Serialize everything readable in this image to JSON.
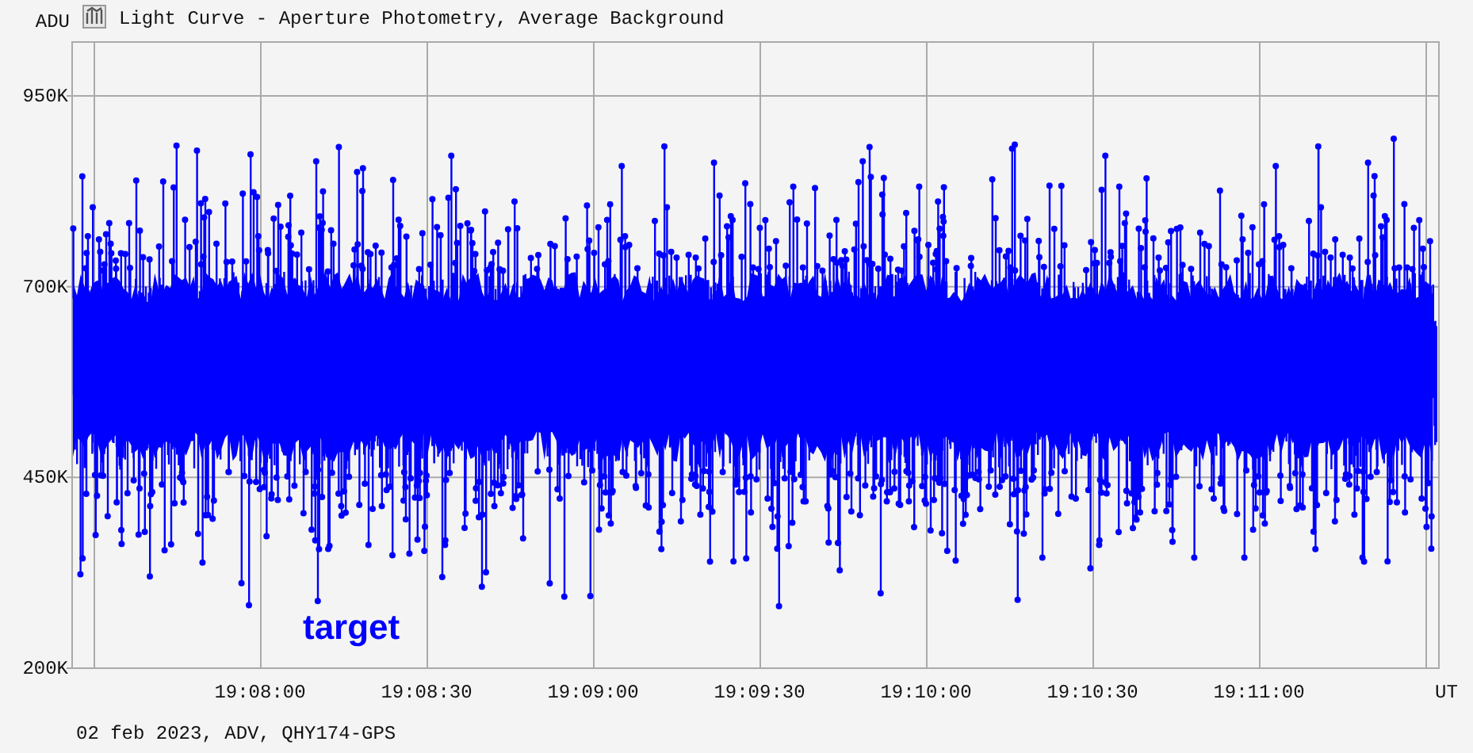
{
  "window": {
    "title": "Light Curve - Aperture Photometry, Average Background"
  },
  "chart": {
    "y_unit": "ADU",
    "y_ticks": [
      "950K",
      "700K",
      "450K",
      "200K"
    ],
    "x_ticks": [
      "19:08:00",
      "19:08:30",
      "19:09:00",
      "19:09:30",
      "19:10:00",
      "19:10:30",
      "19:11:00"
    ],
    "x_unit": "UT",
    "series_label": "target"
  },
  "status_bar": "02 feb 2023, ADV, QHY174-GPS"
}
